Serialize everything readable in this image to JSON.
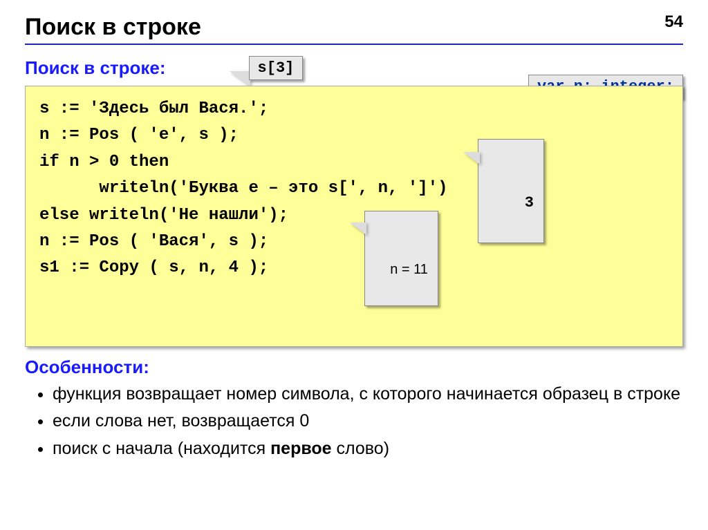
{
  "page_number": "54",
  "title": "Поиск в строке",
  "subhead": "Поиск в строке:",
  "callout_s3": "s[3]",
  "callout_var": "var n: integer;",
  "code": "s := 'Здесь был Вася.';\nn := Pos ( 'е', s );\nif n > 0 then\n      writeln('Буква е – это s[', n, ']')\nelse writeln('Не нашли');\nn := Pos ( 'Вася', s );\ns1 := Copy ( s, n, 4 );",
  "callout_three": "3",
  "callout_n11": "n = 11",
  "features_heading": "Особенности:",
  "features": [
    "функция возвращает номер символа, с которого начинается образец в строке",
    "если слова нет, возвращается 0"
  ],
  "feature3_pre": "поиск с начала (находится ",
  "feature3_bold": "первое",
  "feature3_post": " слово)"
}
